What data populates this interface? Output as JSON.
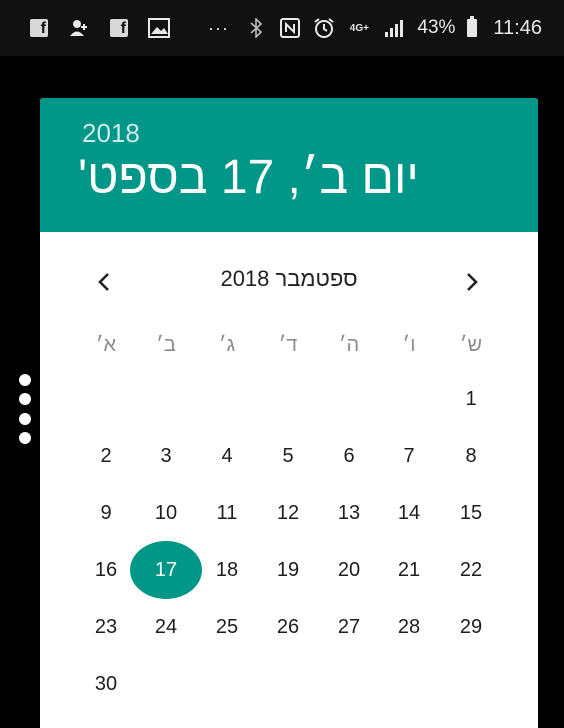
{
  "status_bar": {
    "dots": "···",
    "battery": "43%",
    "time": "11:46",
    "network": "4G+",
    "icons": [
      "facebook-icon",
      "add-person-icon",
      "facebook-icon",
      "gallery-icon",
      "bluetooth-icon",
      "nfc-icon",
      "alarm-icon",
      "network-icon",
      "signal-icon",
      "battery-icon"
    ]
  },
  "header": {
    "year": "2018",
    "date": "יום ב׳, 17 בספט'"
  },
  "calendar": {
    "month_title": "ספטמבר 2018",
    "weekdays": [
      "א׳",
      "ב׳",
      "ג׳",
      "ד׳",
      "ה׳",
      "ו׳",
      "ש׳"
    ],
    "weeks": [
      [
        "",
        "",
        "",
        "",
        "",
        "",
        "1"
      ],
      [
        "2",
        "3",
        "4",
        "5",
        "6",
        "7",
        "8"
      ],
      [
        "9",
        "10",
        "11",
        "12",
        "13",
        "14",
        "15"
      ],
      [
        "16",
        "17",
        "18",
        "19",
        "20",
        "21",
        "22"
      ],
      [
        "23",
        "24",
        "25",
        "26",
        "27",
        "28",
        "29"
      ],
      [
        "30",
        "",
        "",
        "",
        "",
        "",
        ""
      ]
    ],
    "selected_day": "17"
  },
  "colors": {
    "accent": "#009688",
    "status_bar": "#111111",
    "background": "#000000"
  }
}
